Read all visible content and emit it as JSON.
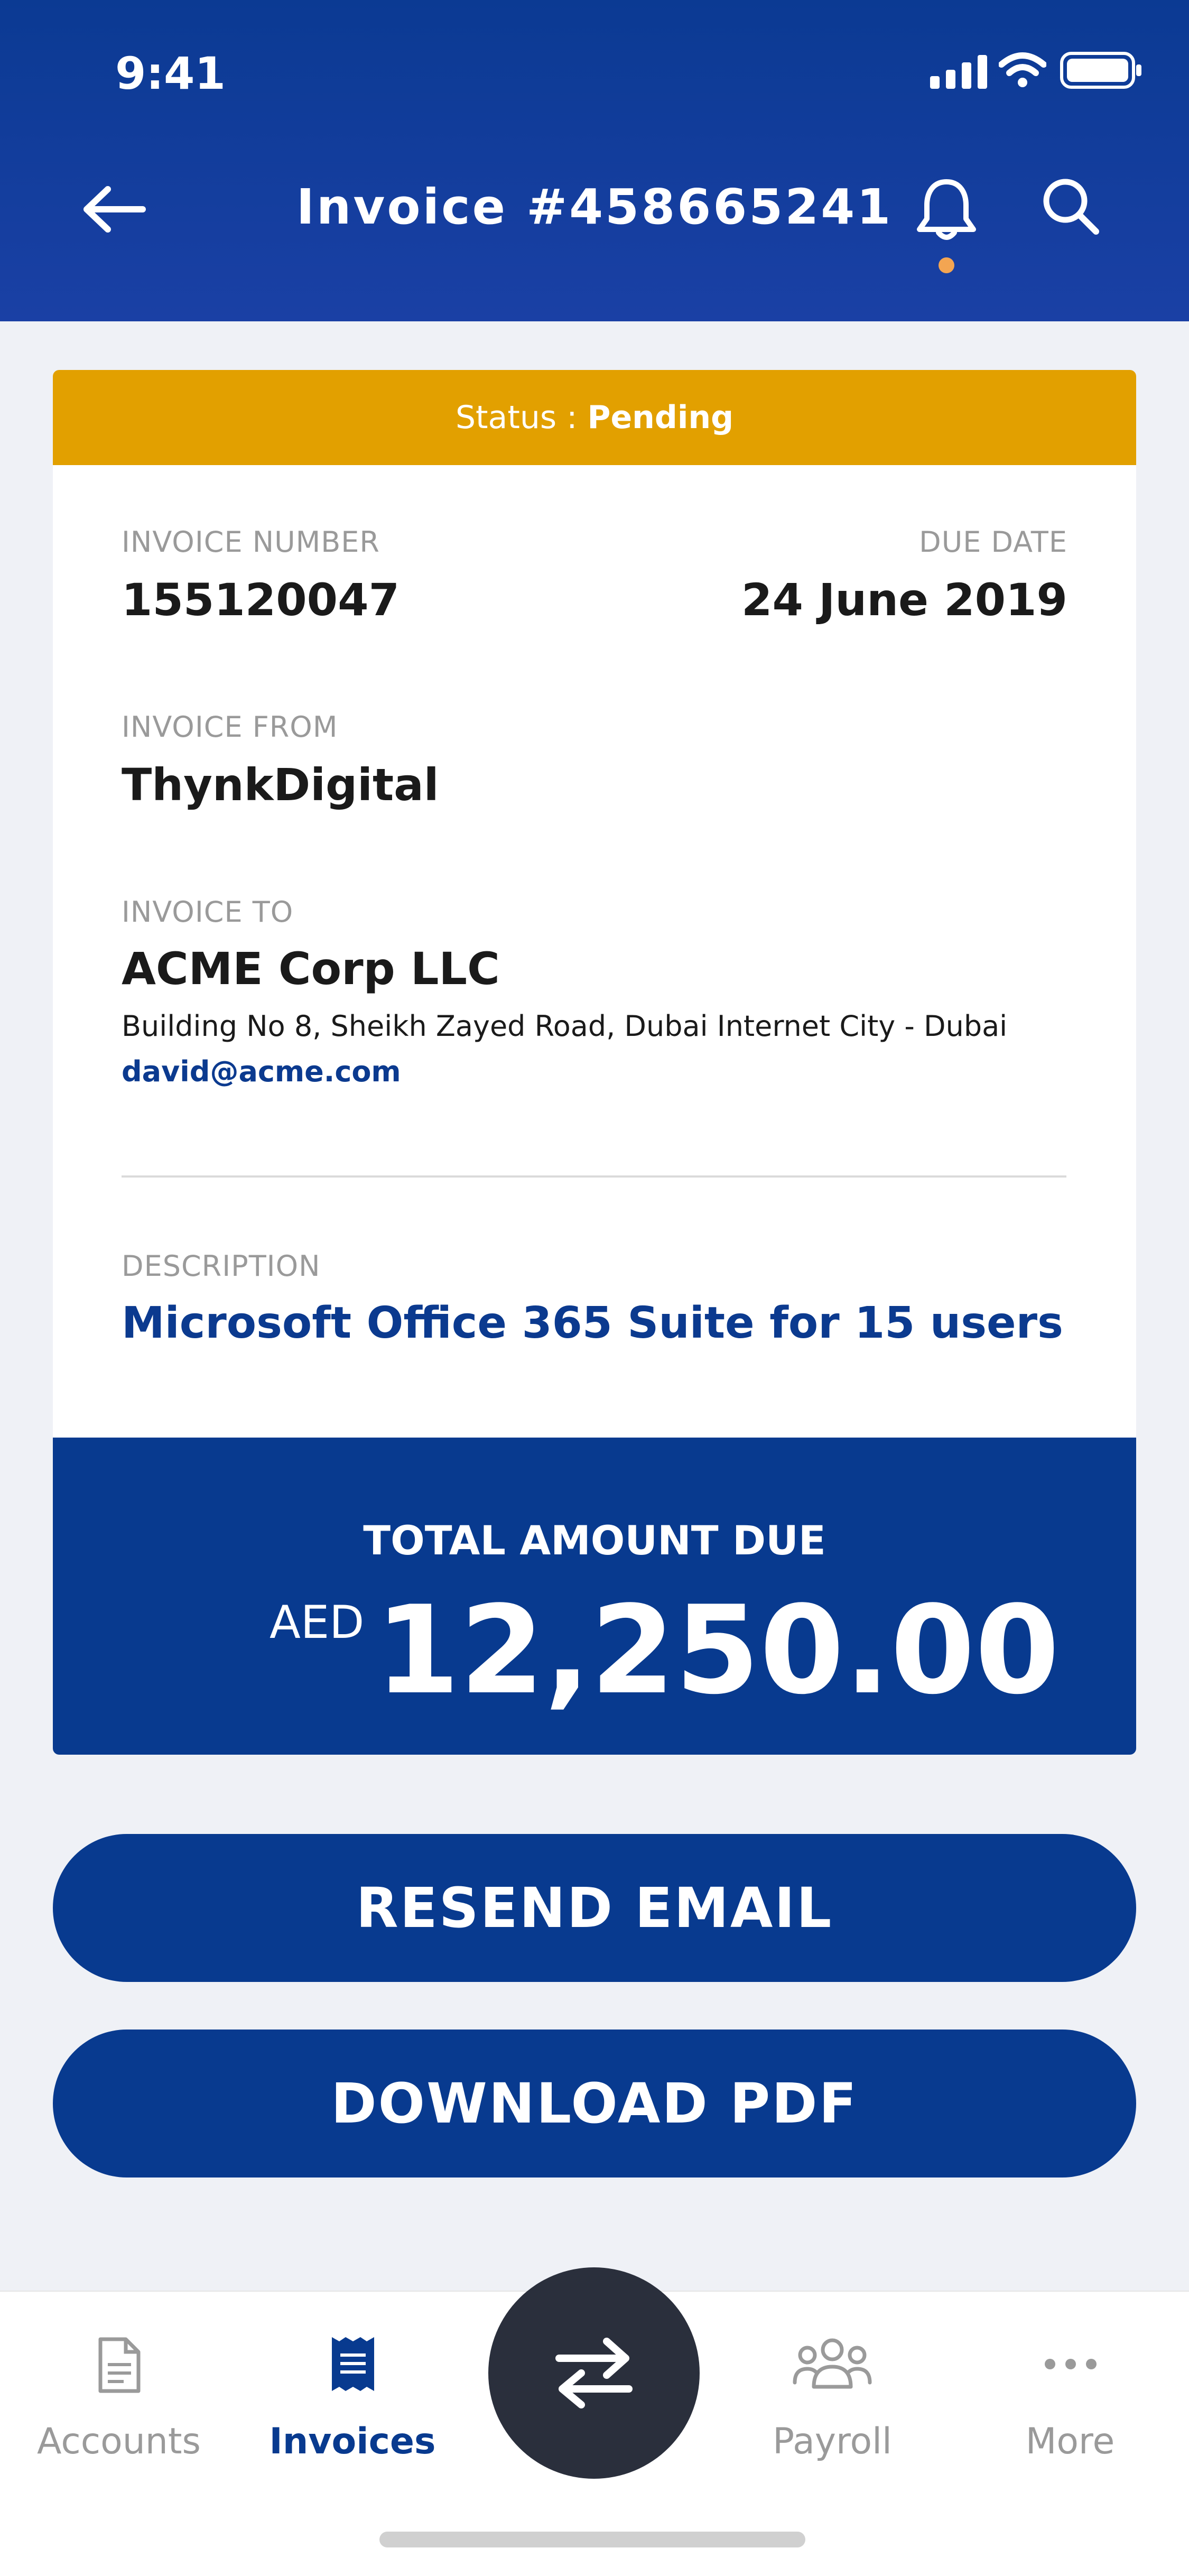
{
  "status_bar": {
    "time": "9:41"
  },
  "header": {
    "title": "Invoice #458665241"
  },
  "invoice": {
    "status_label": "Status : ",
    "status_value": "Pending",
    "invoice_number_label": "INVOICE NUMBER",
    "invoice_number": "155120047",
    "due_date_label": "DUE DATE",
    "due_date": "24 June 2019",
    "from_label": "INVOICE FROM",
    "from": "ThynkDigital",
    "to_label": "INVOICE TO",
    "to_name": "ACME Corp LLC",
    "to_address": "Building No 8, Sheikh Zayed Road, Dubai Internet City - Dubai",
    "to_email": "david@acme.com",
    "description_label": "DESCRIPTION",
    "description": "Microsoft Office 365 Suite for 15 users",
    "total_label": "TOTAL AMOUNT DUE",
    "currency": "AED",
    "amount": "12,250.00"
  },
  "actions": {
    "resend_label": "RESEND EMAIL",
    "download_label": "DOWNLOAD PDF"
  },
  "tabs": [
    {
      "label": "Accounts",
      "icon": "document-icon",
      "active": false
    },
    {
      "label": "Invoices",
      "icon": "receipt-icon",
      "active": true
    },
    {
      "label": "",
      "icon": "transfer-icon",
      "active": false
    },
    {
      "label": "Payroll",
      "icon": "people-icon",
      "active": false
    },
    {
      "label": "More",
      "icon": "more-icon",
      "active": false
    }
  ],
  "colors": {
    "primary": "#083a8f",
    "status_pending": "#e2a000",
    "notification_dot": "#f3a552",
    "fab": "#2a2f3c"
  }
}
